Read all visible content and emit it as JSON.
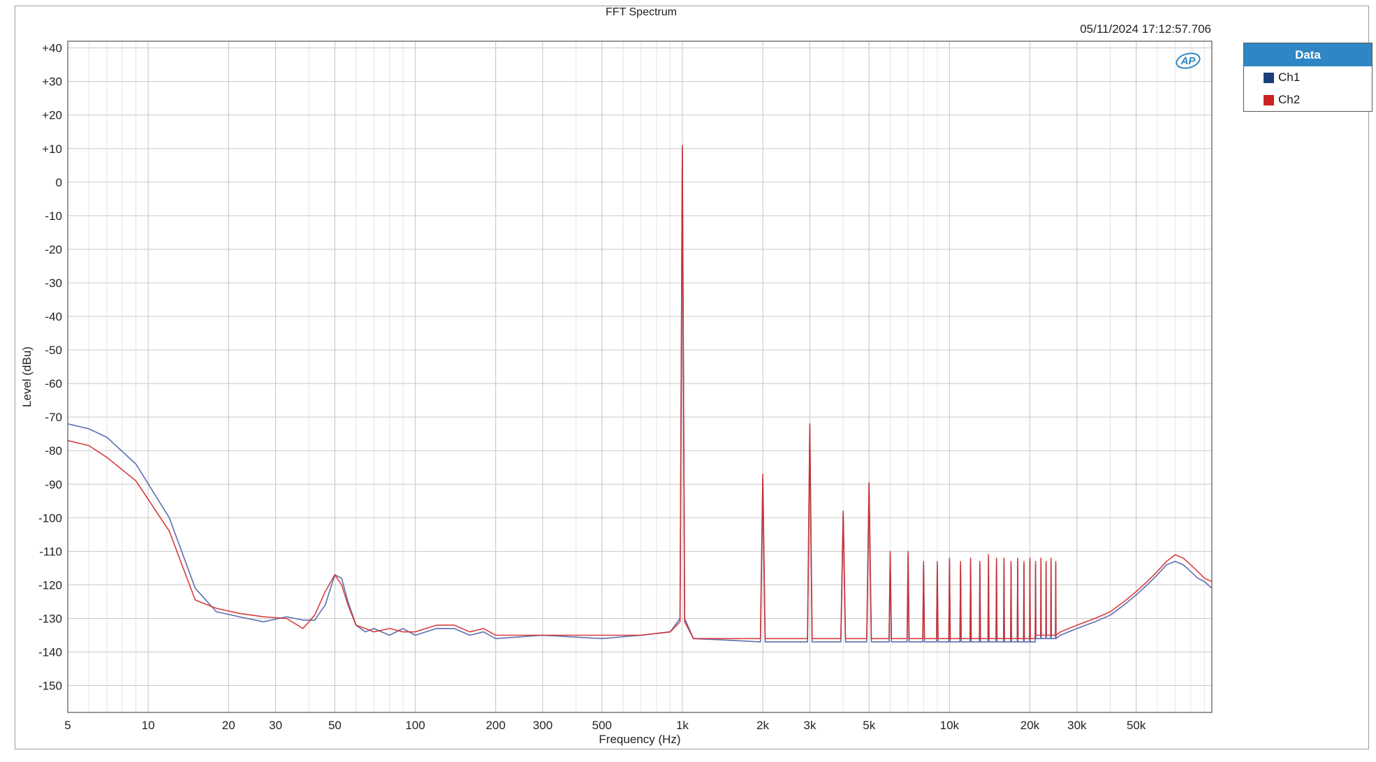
{
  "window": {
    "chart_title": "FFT Spectrum",
    "timestamp": "05/11/2024 17:12:57.706",
    "logo_text": "AP"
  },
  "legend": {
    "header": "Data",
    "items": [
      {
        "label": "Ch1",
        "color": "#1c3f7a"
      },
      {
        "label": "Ch2",
        "color": "#cc2222"
      }
    ]
  },
  "chart_data": {
    "type": "line",
    "title": "FFT Spectrum",
    "xlabel": "Frequency (Hz)",
    "ylabel": "Level (dBu)",
    "x_scale": "log",
    "xlim": [
      5,
      96000
    ],
    "ylim": [
      -158,
      42
    ],
    "grid": true,
    "legend_position": "right",
    "x_ticks": [
      {
        "value": 5,
        "label": "5"
      },
      {
        "value": 10,
        "label": "10"
      },
      {
        "value": 20,
        "label": "20"
      },
      {
        "value": 30,
        "label": "30"
      },
      {
        "value": 50,
        "label": "50"
      },
      {
        "value": 100,
        "label": "100"
      },
      {
        "value": 200,
        "label": "200"
      },
      {
        "value": 300,
        "label": "300"
      },
      {
        "value": 500,
        "label": "500"
      },
      {
        "value": 1000,
        "label": "1k"
      },
      {
        "value": 2000,
        "label": "2k"
      },
      {
        "value": 3000,
        "label": "3k"
      },
      {
        "value": 5000,
        "label": "5k"
      },
      {
        "value": 10000,
        "label": "10k"
      },
      {
        "value": 20000,
        "label": "20k"
      },
      {
        "value": 30000,
        "label": "30k"
      },
      {
        "value": 50000,
        "label": "50k"
      }
    ],
    "y_ticks": [
      {
        "value": 40,
        "label": "+40"
      },
      {
        "value": 30,
        "label": "+30"
      },
      {
        "value": 20,
        "label": "+20"
      },
      {
        "value": 10,
        "label": "+10"
      },
      {
        "value": 0,
        "label": "0"
      },
      {
        "value": -10,
        "label": "-10"
      },
      {
        "value": -20,
        "label": "-20"
      },
      {
        "value": -30,
        "label": "-30"
      },
      {
        "value": -40,
        "label": "-40"
      },
      {
        "value": -50,
        "label": "-50"
      },
      {
        "value": -60,
        "label": "-60"
      },
      {
        "value": -70,
        "label": "-70"
      },
      {
        "value": -80,
        "label": "-80"
      },
      {
        "value": -90,
        "label": "-90"
      },
      {
        "value": -100,
        "label": "-100"
      },
      {
        "value": -110,
        "label": "-110"
      },
      {
        "value": -120,
        "label": "-120"
      },
      {
        "value": -130,
        "label": "-130"
      },
      {
        "value": -140,
        "label": "-140"
      },
      {
        "value": -150,
        "label": "-150"
      }
    ],
    "series": [
      {
        "name": "Ch1",
        "color": "#4a5fa8",
        "x": [
          5,
          6,
          7,
          9,
          12,
          15,
          18,
          22,
          27,
          33,
          38,
          42,
          46,
          50,
          53,
          56,
          60,
          65,
          70,
          80,
          90,
          100,
          120,
          140,
          160,
          180,
          200,
          300,
          500,
          700,
          900,
          980,
          1000,
          1020,
          1100,
          1500,
          1960,
          2000,
          2040,
          2500,
          2940,
          3000,
          3060,
          3500,
          3920,
          4000,
          4080,
          4500,
          4900,
          5000,
          5100,
          5500,
          5940,
          6000,
          6060,
          6600,
          6940,
          7000,
          7060,
          7600,
          7940,
          8000,
          8060,
          8600,
          8940,
          9000,
          9060,
          9600,
          9940,
          10000,
          10060,
          10600,
          10940,
          11000,
          11060,
          11600,
          11940,
          12000,
          12060,
          12600,
          12940,
          13000,
          13060,
          13600,
          13940,
          14000,
          14060,
          14600,
          14940,
          15000,
          15060,
          15600,
          15940,
          16000,
          16060,
          16600,
          16940,
          17000,
          17060,
          17600,
          17940,
          18000,
          18060,
          18600,
          18940,
          19000,
          19060,
          19600,
          19940,
          20000,
          20060,
          20600,
          20940,
          21000,
          21060,
          21600,
          21940,
          22000,
          22060,
          22600,
          22940,
          23000,
          23060,
          23600,
          23940,
          24000,
          24060,
          24600,
          24940,
          25000,
          25060,
          26000,
          30000,
          35000,
          40000,
          45000,
          50000,
          55000,
          60000,
          65000,
          70000,
          75000,
          80000,
          85000,
          90000,
          96000
        ],
        "y": [
          -72,
          -73.5,
          -76,
          -84,
          -100,
          -121,
          -128,
          -129.5,
          -131,
          -129.5,
          -130.5,
          -130.5,
          -126,
          -117,
          -118,
          -125,
          -132,
          -134,
          -133,
          -135,
          -133,
          -135,
          -133,
          -133,
          -135,
          -134,
          -136,
          -135,
          -136,
          -135,
          -134,
          -130,
          10,
          -130,
          -136,
          -136.5,
          -137,
          -88,
          -137,
          -137,
          -137,
          -73,
          -137,
          -137,
          -137,
          -99,
          -137,
          -137,
          -137,
          -90,
          -137,
          -137,
          -137,
          -111,
          -137,
          -137,
          -137,
          -111,
          -137,
          -137,
          -137,
          -114,
          -137,
          -137,
          -137,
          -114,
          -137,
          -137,
          -137,
          -113,
          -137,
          -137,
          -137,
          -114,
          -137,
          -137,
          -137,
          -113,
          -137,
          -137,
          -137,
          -114,
          -137,
          -137,
          -137,
          -112,
          -137,
          -137,
          -137,
          -113,
          -137,
          -137,
          -137,
          -113,
          -137,
          -137,
          -137,
          -114,
          -137,
          -137,
          -137,
          -113,
          -137,
          -137,
          -137,
          -114,
          -137,
          -137,
          -137,
          -113,
          -137,
          -137,
          -137,
          -114,
          -136,
          -136,
          -136,
          -113,
          -136,
          -136,
          -136,
          -114,
          -136,
          -136,
          -136,
          -113,
          -136,
          -136,
          -136,
          -114,
          -136,
          -135,
          -133,
          -131,
          -129,
          -126,
          -123,
          -120,
          -117,
          -114,
          -113,
          -114,
          -116,
          -118,
          -119,
          -121
        ]
      },
      {
        "name": "Ch2",
        "color": "#d42a2a",
        "x": [
          5,
          6,
          7,
          9,
          12,
          15,
          18,
          22,
          27,
          33,
          38,
          42,
          46,
          50,
          53,
          56,
          60,
          65,
          70,
          80,
          90,
          100,
          120,
          140,
          160,
          180,
          200,
          300,
          500,
          700,
          900,
          980,
          1000,
          1020,
          1100,
          1500,
          1960,
          2000,
          2040,
          2500,
          2940,
          3000,
          3060,
          3500,
          3920,
          4000,
          4080,
          4500,
          4900,
          5000,
          5100,
          5500,
          5940,
          6000,
          6060,
          6600,
          6940,
          7000,
          7060,
          7600,
          7940,
          8000,
          8060,
          8600,
          8940,
          9000,
          9060,
          9600,
          9940,
          10000,
          10060,
          10600,
          10940,
          11000,
          11060,
          11600,
          11940,
          12000,
          12060,
          12600,
          12940,
          13000,
          13060,
          13600,
          13940,
          14000,
          14060,
          14600,
          14940,
          15000,
          15060,
          15600,
          15940,
          16000,
          16060,
          16600,
          16940,
          17000,
          17060,
          17600,
          17940,
          18000,
          18060,
          18600,
          18940,
          19000,
          19060,
          19600,
          19940,
          20000,
          20060,
          20600,
          20940,
          21000,
          21060,
          21600,
          21940,
          22000,
          22060,
          22600,
          22940,
          23000,
          23060,
          23600,
          23940,
          24000,
          24060,
          24600,
          24940,
          25000,
          25060,
          26000,
          30000,
          35000,
          40000,
          45000,
          50000,
          55000,
          60000,
          65000,
          70000,
          75000,
          80000,
          85000,
          90000,
          96000
        ],
        "y": [
          -77,
          -78.5,
          -82,
          -89,
          -104,
          -124.5,
          -127,
          -128.5,
          -129.5,
          -130,
          -133,
          -129,
          -122,
          -117,
          -120,
          -126,
          -132,
          -133,
          -134,
          -133,
          -134,
          -134,
          -132,
          -132,
          -134,
          -133,
          -135,
          -135,
          -135,
          -135,
          -134,
          -131,
          11,
          -131,
          -136,
          -136,
          -136,
          -87,
          -136,
          -136,
          -136,
          -72,
          -136,
          -136,
          -136,
          -98,
          -136,
          -136,
          -136,
          -89.5,
          -136,
          -136,
          -136,
          -110,
          -136,
          -136,
          -136,
          -110,
          -136,
          -136,
          -136,
          -113,
          -136,
          -136,
          -136,
          -113,
          -136,
          -136,
          -136,
          -112,
          -136,
          -136,
          -136,
          -113,
          -136,
          -136,
          -136,
          -112,
          -136,
          -136,
          -136,
          -113,
          -136,
          -136,
          -136,
          -111,
          -136,
          -136,
          -136,
          -112,
          -136,
          -136,
          -136,
          -112,
          -136,
          -136,
          -136,
          -113,
          -136,
          -136,
          -136,
          -112,
          -136,
          -136,
          -136,
          -113,
          -136,
          -136,
          -136,
          -112,
          -136,
          -136,
          -136,
          -113,
          -135,
          -135,
          -135,
          -112,
          -135,
          -135,
          -135,
          -113,
          -135,
          -135,
          -135,
          -112,
          -135,
          -135,
          -135,
          -113,
          -135,
          -134,
          -132,
          -130,
          -128,
          -125,
          -122,
          -119,
          -116,
          -113,
          -111,
          -112,
          -114,
          -116,
          -118,
          -119
        ]
      }
    ]
  }
}
